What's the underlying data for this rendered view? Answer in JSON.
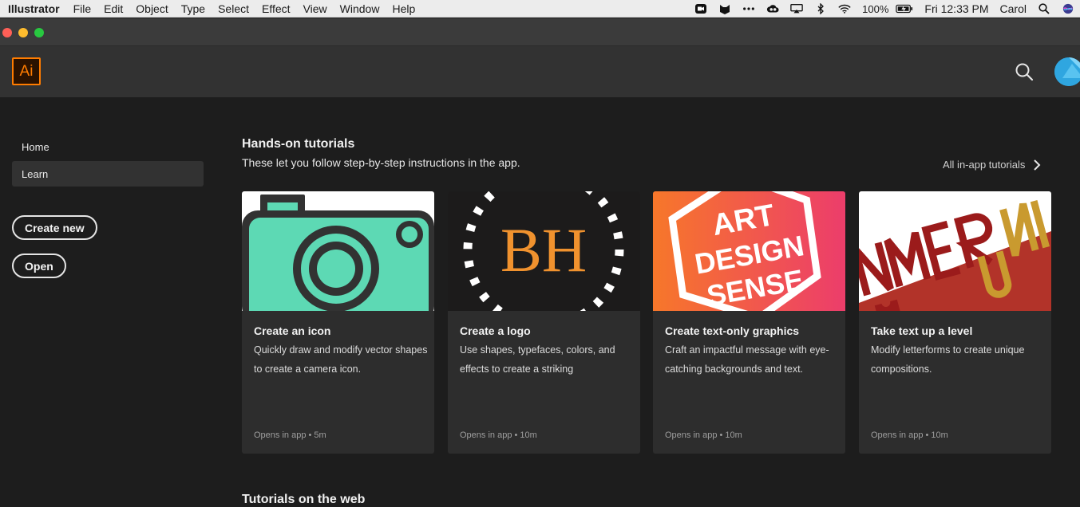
{
  "menubar": {
    "app_name": "Illustrator",
    "items": [
      "File",
      "Edit",
      "Object",
      "Type",
      "Select",
      "Effect",
      "View",
      "Window",
      "Help"
    ],
    "battery": "100%",
    "clock": "Fri 12:33 PM",
    "user": "Carol"
  },
  "app": {
    "logo_text": "Ai"
  },
  "sidebar": {
    "home": "Home",
    "learn": "Learn",
    "create_new": "Create new",
    "open": "Open"
  },
  "section": {
    "title": "Hands-on tutorials",
    "subtitle": "These let you follow step-by-step instructions in the app.",
    "all_link": "All in-app tutorials"
  },
  "cards": [
    {
      "title": "Create an icon",
      "desc": "Quickly draw and modify vector shapes to create a camera icon.",
      "meta": "Opens in app  •  5m"
    },
    {
      "title": "Create a logo",
      "desc": "Use shapes, typefaces, colors, and effects to create a striking",
      "meta": "Opens in app  •  10m",
      "thumb_text": "BH"
    },
    {
      "title": "Create text-only graphics",
      "desc": "Craft an impactful message with eye-catching backgrounds and text.",
      "meta": "Opens in app  •  10m",
      "thumb_text": [
        "ART",
        "DESIGN",
        "SENSE"
      ]
    },
    {
      "title": "Take text up a level",
      "desc": "Modify letterforms to create unique compositions.",
      "meta": "Opens in app  •  10m"
    }
  ],
  "section2": {
    "title": "Tutorials on the web"
  },
  "colors": {
    "accent": "#ff7c00",
    "background": "#1d1d1d",
    "card": "#2d2d2d"
  }
}
